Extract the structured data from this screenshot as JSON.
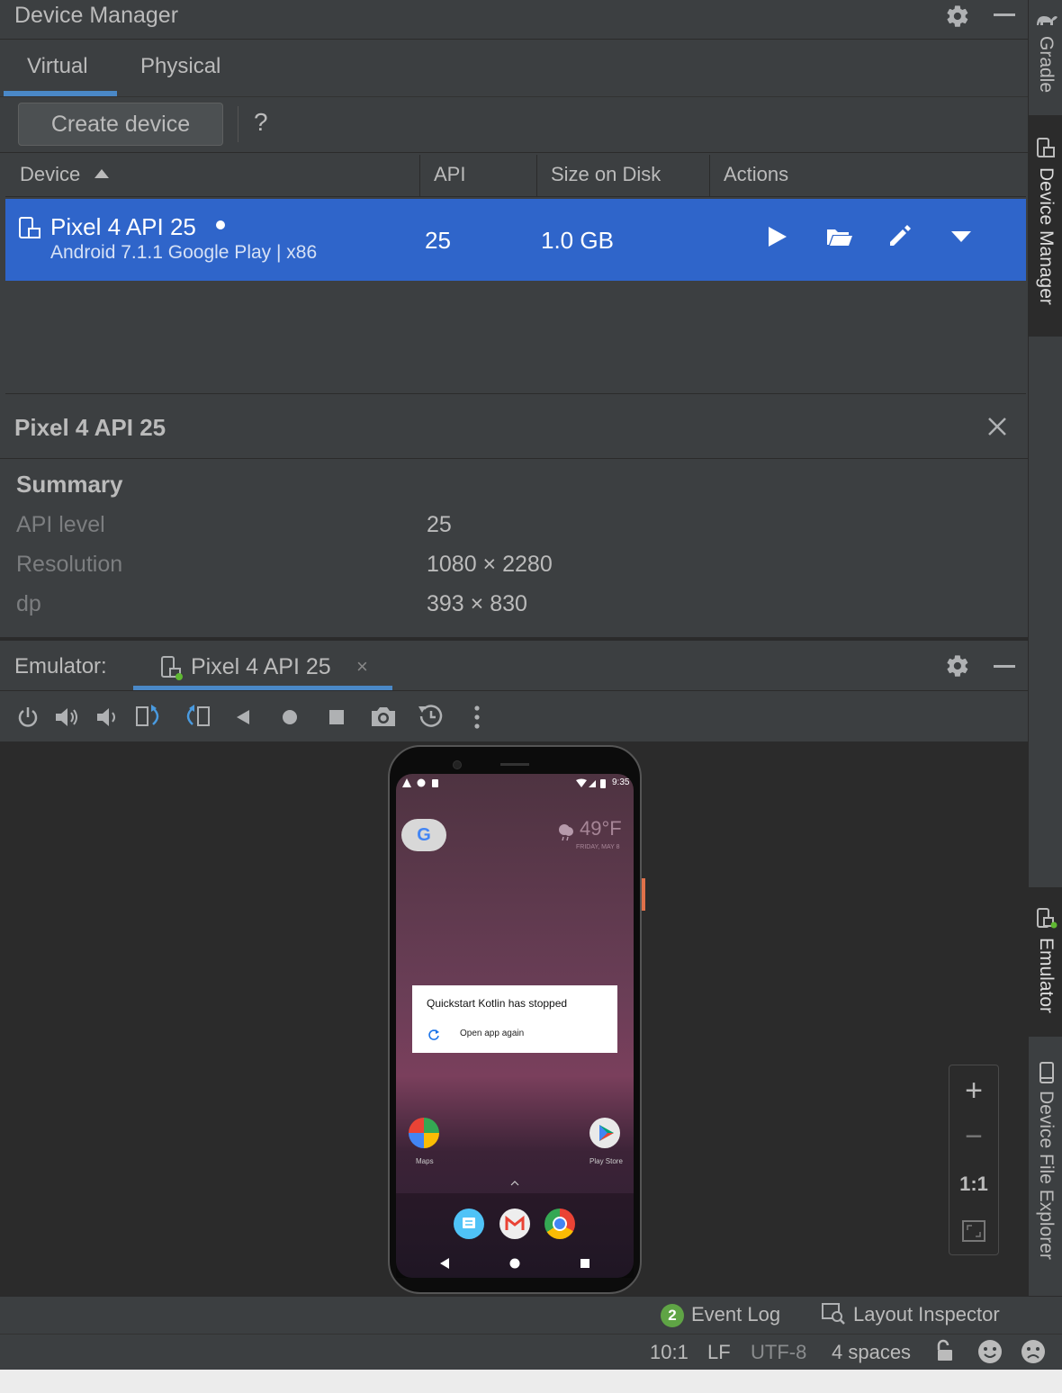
{
  "device_manager": {
    "title": "Device Manager",
    "tabs": [
      {
        "label": "Virtual",
        "active": true
      },
      {
        "label": "Physical",
        "active": false
      }
    ],
    "create_label": "Create device",
    "help_label": "?",
    "columns": {
      "device": "Device",
      "api": "API",
      "size": "Size on Disk",
      "actions": "Actions"
    },
    "row": {
      "name": "Pixel 4 API 25",
      "subtitle": "Android 7.1.1 Google Play | x86",
      "api": "25",
      "size": "1.0 GB"
    },
    "action_icons": [
      "play-icon",
      "folder-open-icon",
      "pencil-icon",
      "dropdown-triangle-icon"
    ]
  },
  "details": {
    "title": "Pixel 4 API 25",
    "summary_heading": "Summary",
    "rows": [
      {
        "key": "API level",
        "value": "25"
      },
      {
        "key": "Resolution",
        "value": "1080 × 2280"
      },
      {
        "key": "dp",
        "value": "393 × 830"
      }
    ]
  },
  "emulator": {
    "label": "Emulator:",
    "tab_label": "Pixel 4 API 25",
    "close_label": "×",
    "toolbar_icons": [
      "power-icon",
      "volume-up-icon",
      "volume-down-icon",
      "rotate-left-icon",
      "rotate-right-icon",
      "back-icon",
      "home-icon",
      "overview-icon",
      "camera-icon",
      "snapshot-icon",
      "more-icon"
    ],
    "phone": {
      "time": "9:35",
      "google_letter": "G",
      "weather_temp": "49°F",
      "weather_date": "FRIDAY, MAY 8",
      "dialog_title": "Quickstart Kotlin has stopped",
      "dialog_action": "Open app again",
      "apps": [
        {
          "label": "Maps"
        },
        {
          "label": "Play Store"
        }
      ]
    },
    "zoom": {
      "plus": "+",
      "minus": "−",
      "actual": "1:1"
    }
  },
  "status": {
    "event_count": "2",
    "event_log": "Event Log",
    "layout_inspector": "Layout Inspector",
    "position": "10:1",
    "line_sep": "LF",
    "encoding": "UTF-8",
    "indent": "4 spaces"
  },
  "right_tools": {
    "gradle": "Gradle",
    "device_manager": "Device Manager",
    "emulator": "Emulator",
    "device_file_explorer": "Device File Explorer"
  },
  "colors": {
    "selection": "#2f65ca",
    "accent": "#4a88c7",
    "background": "#3c3f41"
  }
}
